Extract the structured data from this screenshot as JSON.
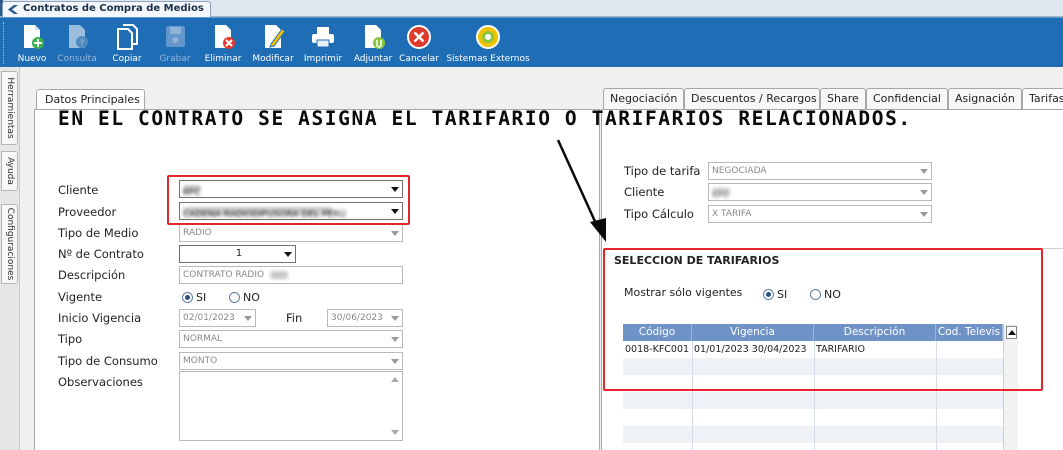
{
  "window": {
    "tab_title": "Contratos de Compra de Medios"
  },
  "toolbar": [
    {
      "label": "Nuevo",
      "icon": "new-doc-icon",
      "enabled": true
    },
    {
      "label": "Consulta",
      "icon": "query-doc-icon",
      "enabled": false
    },
    {
      "label": "Copiar",
      "icon": "copy-icon",
      "enabled": true
    },
    {
      "label": "Grabar",
      "icon": "save-disk-icon",
      "enabled": false
    },
    {
      "label": "Eliminar",
      "icon": "delete-doc-icon",
      "enabled": true
    },
    {
      "label": "Modificar",
      "icon": "edit-doc-icon",
      "enabled": true
    },
    {
      "label": "Imprimir",
      "icon": "printer-icon",
      "enabled": true
    },
    {
      "label": "Adjuntar",
      "icon": "attach-doc-icon",
      "enabled": true
    },
    {
      "label": "Cancelar",
      "icon": "cancel-icon",
      "enabled": true
    },
    {
      "label": "Sistemas Externos",
      "icon": "external-systems-icon",
      "enabled": true
    }
  ],
  "side_tabs": [
    "Herramientas",
    "Ayuda",
    "Configuraciones"
  ],
  "left_panel": {
    "tab": "Datos Principales",
    "labels": {
      "cliente": "Cliente",
      "proveedor": "Proveedor",
      "tipo_medio": "Tipo de Medio",
      "num_contrato": "Nº de Contrato",
      "descripcion": "Descripción",
      "vigente": "Vigente",
      "inicio_vigencia": "Inicio Vigencia",
      "fin": "Fin",
      "tipo": "Tipo",
      "tipo_consumo": "Tipo de Consumo",
      "observaciones": "Observaciones"
    },
    "values": {
      "cliente": "KFC",
      "proveedor": "CADENA RADIODIFUSORA DEL PERÚ",
      "tipo_medio": "RADIO",
      "num_contrato": "1",
      "descripcion": "CONTRATO RADIO",
      "vigente_si": "SI",
      "vigente_no": "NO",
      "inicio_vigencia": "02/01/2023",
      "fin": "30/06/2023",
      "tipo": "NORMAL",
      "tipo_consumo": "MONTO",
      "observaciones": ""
    }
  },
  "right_panel": {
    "tabs": [
      "Negociación",
      "Descuentos / Recargos",
      "Share",
      "Confidencial",
      "Asignación",
      "Tarifas"
    ],
    "labels": {
      "tipo_tarifa": "Tipo de tarifa",
      "cliente": "Cliente",
      "tipo_calculo": "Tipo Cálculo"
    },
    "values": {
      "tipo_tarifa": "NEGOCIADA",
      "cliente": "KFC",
      "tipo_calculo": "X TARIFA"
    },
    "section_title": "SELECCION DE TARIFARIOS",
    "mostrar_label": "Mostrar sólo vigentes",
    "mostrar_si": "SI",
    "mostrar_no": "NO",
    "grid": {
      "columns": [
        "Código",
        "Vigencia",
        "Descripción",
        "Cod. Televis"
      ],
      "rows": [
        [
          "0018-KFC001",
          "01/01/2023 30/04/2023",
          "TARIFARIO",
          ""
        ]
      ]
    }
  },
  "annotation": {
    "text": "EN EL CONTRATO SE ASIGNA EL TARIFARIO O TARIFARIOS RELACIONADOS.",
    "highlight_color": "#e4252b"
  }
}
